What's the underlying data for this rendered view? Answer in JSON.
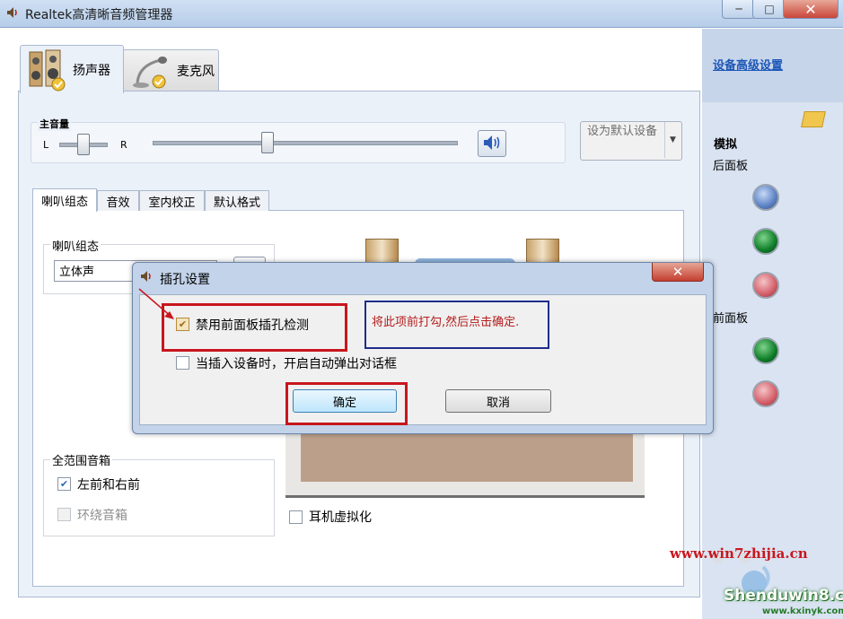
{
  "window": {
    "title": "Realtek高清晰音频管理器"
  },
  "device_tabs": [
    {
      "label": "扬声器",
      "selected": true
    },
    {
      "label": "麦克风",
      "selected": false
    }
  ],
  "volume": {
    "label": "主音量",
    "left": "L",
    "right": "R",
    "default_button": "设为默认设备"
  },
  "sub_tabs": [
    "喇叭组态",
    "音效",
    "室内校正",
    "默认格式"
  ],
  "speaker_config": {
    "legend": "喇叭组态",
    "selected": "立体声"
  },
  "full_range": {
    "legend": "全范围音箱",
    "options": [
      {
        "label": "左前和右前",
        "checked": true,
        "enabled": true
      },
      {
        "label": "环绕音箱",
        "checked": false,
        "enabled": false
      }
    ]
  },
  "headphone": {
    "label": "耳机虚拟化",
    "checked": false
  },
  "right_panel": {
    "advanced_link": "设备高级设置",
    "analog": "模拟",
    "rear": "后面板",
    "front": "前面板"
  },
  "dialog": {
    "title": "插孔设置",
    "option1": {
      "label": "禁用前面板插孔检测",
      "checked": true
    },
    "option2": {
      "label": "当插入设备时，开启自动弹出对话框",
      "checked": false
    },
    "ok": "确定",
    "cancel": "取消"
  },
  "annotation": {
    "note": "将此项前打勾,然后点击确定."
  },
  "watermark": {
    "site1": "www.win7zhijia.cn",
    "site2": "Shenduwin8.com",
    "site3": "www.kxinyk.com"
  },
  "colors": {
    "link": "#1d57b7",
    "annotation_red": "#c8161d",
    "annotation_blue": "#1f2d8a",
    "jack_blue": "#5b81c4",
    "jack_green": "#0e7d28",
    "jack_pink": "#d45f6a"
  },
  "icons": {
    "title": "speaker-icon",
    "dialog_title": "speaker-icon",
    "speaker_tab": "loudspeaker-icon",
    "mic_tab": "microphone-icon",
    "volume_button": "speaker-volume-icon",
    "play": "play-icon",
    "folder": "folder-icon"
  }
}
